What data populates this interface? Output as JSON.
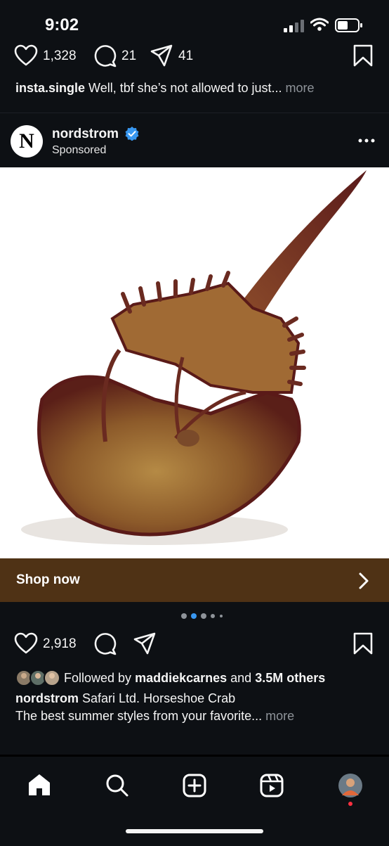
{
  "status_bar": {
    "time": "9:02"
  },
  "previous_post": {
    "likes": "1,328",
    "comments": "21",
    "shares": "41",
    "username": "insta.single",
    "caption": "Well, tbf she’s not allowed to just...",
    "more": "more"
  },
  "sponsored_post": {
    "avatar_letter": "N",
    "username": "nordstrom",
    "subtitle": "Sponsored",
    "cta_label": "Shop now",
    "likes": "2,918",
    "followed_by_prefix": "Followed by",
    "followed_by_user": "maddiekcarnes",
    "followed_by_and": "and",
    "followed_by_others": "3.5M others",
    "caption_user": "nordstrom",
    "caption_text": "Safari Ltd. Horseshoe Crab",
    "caption_line2": "The best summer styles from your favorite...",
    "more": "more",
    "carousel": {
      "count": 5,
      "active": 1
    }
  },
  "bottom_nav": {
    "items": [
      "home-icon",
      "search-icon",
      "create-icon",
      "reels-icon",
      "profile-avatar"
    ]
  },
  "colors": {
    "background": "#0d1014",
    "cta_bar": "#4f3215",
    "verified": "#3897f0",
    "carousel_active": "#3897f0",
    "notification_dot": "#ff3040"
  }
}
